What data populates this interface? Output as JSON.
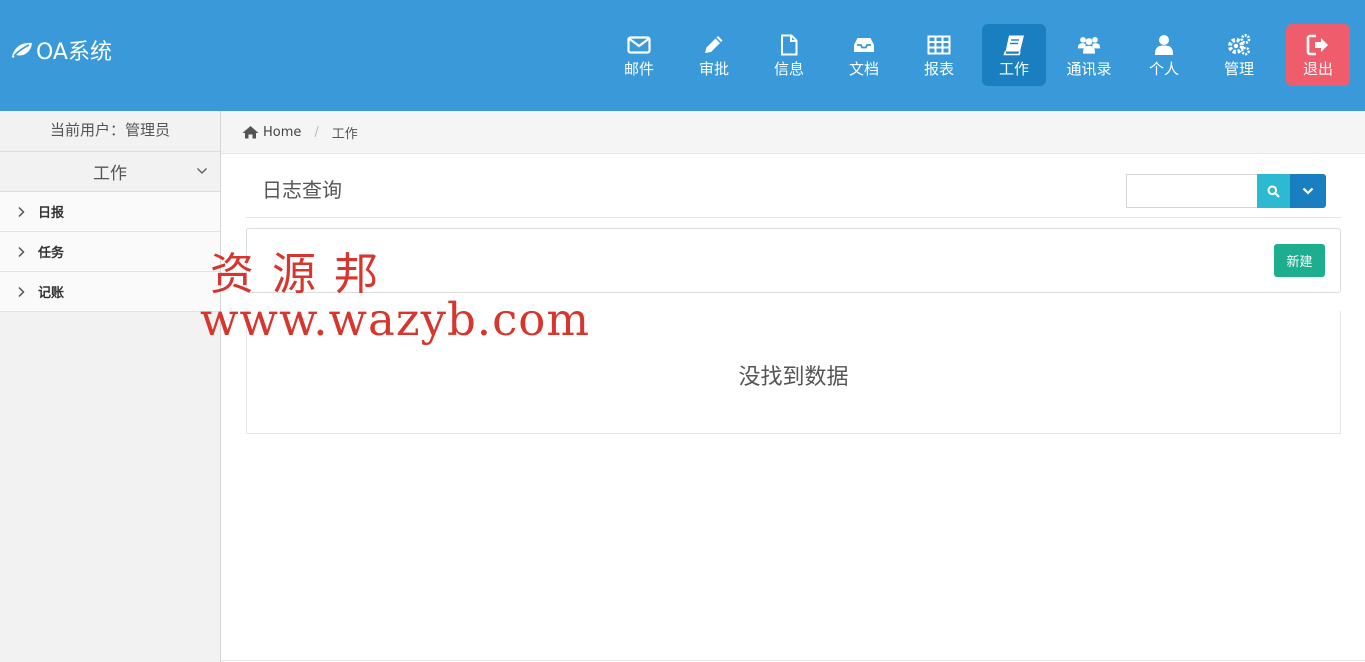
{
  "app": {
    "title": "OA系统"
  },
  "nav": [
    {
      "label": "邮件",
      "icon": "envelope-icon"
    },
    {
      "label": "审批",
      "icon": "pencil-icon"
    },
    {
      "label": "信息",
      "icon": "file-icon"
    },
    {
      "label": "文档",
      "icon": "inbox-icon"
    },
    {
      "label": "报表",
      "icon": "table-icon"
    },
    {
      "label": "工作",
      "icon": "book-icon",
      "active": true
    },
    {
      "label": "通讯录",
      "icon": "users-icon"
    },
    {
      "label": "个人",
      "icon": "user-icon"
    },
    {
      "label": "管理",
      "icon": "gears-icon"
    },
    {
      "label": "退出",
      "icon": "sign-out-icon"
    }
  ],
  "sidebar": {
    "current_user": "当前用户：管理员",
    "group": "工作",
    "items": [
      {
        "label": "日报"
      },
      {
        "label": "任务"
      },
      {
        "label": "记账"
      }
    ]
  },
  "breadcrumb": {
    "home": "Home",
    "separator": "/",
    "current": "工作"
  },
  "main": {
    "title": "日志查询",
    "search": {
      "value": "",
      "placeholder": ""
    },
    "new_button": "新建",
    "empty_text": "没找到数据"
  },
  "watermark": {
    "cn": "资源邦",
    "url": "www.wazyb.com"
  },
  "colors": {
    "header": "#3a9ad9",
    "nav_active": "#1a7fc1",
    "logout": "#ef5d6c",
    "search_button": "#2bbad2",
    "new_button": "#1cae8f",
    "watermark": "#d6362e"
  }
}
